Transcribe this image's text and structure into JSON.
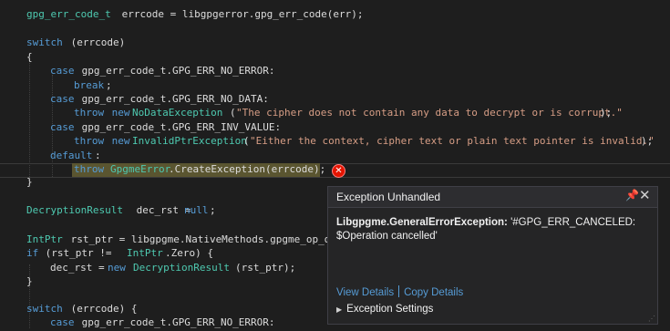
{
  "editor": {
    "line1": {
      "type": "gpg_err_code_t",
      "a": " errcode = libgpgerror.gpg_err_code(err);"
    },
    "line3": {
      "kw": "switch",
      "a": " (errcode)"
    },
    "line4": {
      "a": "{"
    },
    "line5": {
      "kw": "case",
      "a": " gpg_err_code_t.GPG_ERR_NO_ERROR:"
    },
    "line6": {
      "kw": "break",
      "a": ";"
    },
    "line7": {
      "kw": "case",
      "a": " gpg_err_code_t.GPG_ERR_NO_DATA:"
    },
    "line8": {
      "kw1": "throw",
      "kw2": " new ",
      "type": "NoDataException",
      "a": "(",
      "str": "\"The cipher does not contain any data to decrypt or is corrupt.\"",
      "b": ");"
    },
    "line9": {
      "kw": "case",
      "a": " gpg_err_code_t.GPG_ERR_INV_VALUE:"
    },
    "line10": {
      "kw1": "throw",
      "kw2": " new ",
      "type": "InvalidPtrException",
      "a": "(",
      "str": "\"Either the context, cipher text or plain text pointer is invalid.\"",
      "b": ");"
    },
    "line11": {
      "kw": "default",
      "a": ":"
    },
    "line12": {
      "kw": "throw",
      "a": " ",
      "type": "GpgmeError",
      "b": ".CreateException(errcode);"
    },
    "line13": {
      "a": "}"
    },
    "line15": {
      "type": "DecryptionResult",
      "a": " dec_rst = ",
      "kw": "null",
      "b": ";"
    },
    "line17": {
      "type": "IntPtr",
      "a": " rst_ptr = libgpgme.NativeMethods.gpgme_op_dec"
    },
    "line18": {
      "kw": "if",
      "a": " (rst_ptr != ",
      "type": "IntPtr",
      "b": ".Zero) {"
    },
    "line19": {
      "a": "dec_rst = ",
      "kw": "new",
      "sp": " ",
      "type": "DecryptionResult",
      "b": "(rst_ptr);"
    },
    "line20": {
      "a": "}"
    },
    "line22": {
      "kw": "switch",
      "a": " (errcode) {"
    },
    "line23": {
      "kw": "case",
      "a": " gpg_err_code_t.GPG_ERR_NO_ERROR:"
    }
  },
  "popup": {
    "title": "Exception Unhandled",
    "pin_glyph": "📌",
    "close_glyph": "✕",
    "exception_type": "Libgpgme.GeneralErrorException:",
    "exception_msg": " '#GPG_ERR_CANCELED: $Operation cancelled'",
    "view_details": "View Details",
    "copy_details": "Copy Details",
    "settings": "Exception Settings",
    "settings_chevron": "▶",
    "resize_grip": "⋰"
  },
  "icons": {
    "error_glyph": "✕"
  },
  "colors": {
    "keyword": "#569cd6",
    "type": "#4ec9b0",
    "string": "#d69d85",
    "text": "#dcdcdc",
    "error": "#e51400",
    "highlight": "#5a5530"
  }
}
